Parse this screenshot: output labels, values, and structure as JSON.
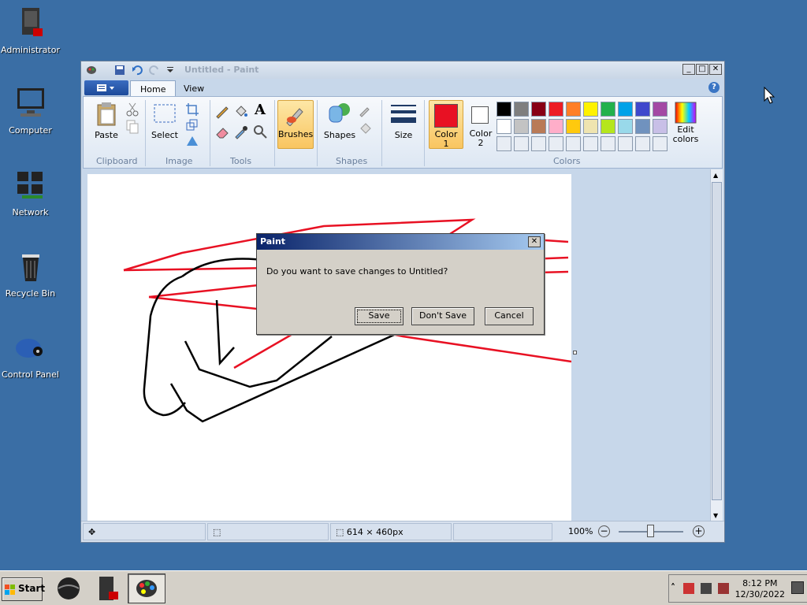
{
  "desktop": {
    "icons": [
      {
        "label": "Administrator",
        "icon": "user-folder-icon"
      },
      {
        "label": "Computer",
        "icon": "computer-icon"
      },
      {
        "label": "Network",
        "icon": "network-icon"
      },
      {
        "label": "Recycle Bin",
        "icon": "recycle-bin-icon"
      },
      {
        "label": "Control Panel",
        "icon": "control-panel-icon"
      }
    ]
  },
  "window": {
    "title": "Untitled - Paint",
    "buttons": {
      "minimize": "_",
      "maximize": "□",
      "close": "✕"
    }
  },
  "ribbon": {
    "tabs": [
      "Home",
      "View"
    ],
    "clipboard": {
      "paste": "Paste",
      "group": "Clipboard"
    },
    "image": {
      "select": "Select",
      "group": "Image"
    },
    "tools": {
      "group": "Tools",
      "text_tool": "A"
    },
    "brushes": "Brushes",
    "shapes": {
      "label": "Shapes",
      "group": "Shapes"
    },
    "size": "Size",
    "color1": {
      "label": "Color",
      "num": "1",
      "value": "#e81123"
    },
    "color2": {
      "label": "Color",
      "num": "2",
      "value": "#ffffff"
    },
    "colors_group": "Colors",
    "edit_colors": {
      "line1": "Edit",
      "line2": "colors"
    },
    "palette_row1": [
      "#000000",
      "#7f7f7f",
      "#880015",
      "#ed1c24",
      "#ff7f27",
      "#fff200",
      "#22b14c",
      "#00a2e8",
      "#3f48cc",
      "#a349a4"
    ],
    "palette_row2": [
      "#ffffff",
      "#c3c3c3",
      "#b97a57",
      "#ffaec9",
      "#ffc90e",
      "#efe4b0",
      "#b5e61d",
      "#99d9ea",
      "#7092be",
      "#c8bfe7"
    ]
  },
  "statusbar": {
    "dimensions": "614 × 460px",
    "zoom": "100%",
    "zoom_out": "−",
    "zoom_in": "+"
  },
  "dialog": {
    "title": "Paint",
    "message": "Do you want to save changes to Untitled?",
    "save": "Save",
    "dont_save": "Don't Save",
    "cancel": "Cancel",
    "close": "✕"
  },
  "taskbar": {
    "start": "Start",
    "time": "8:12 PM",
    "date": "12/30/2022",
    "tray_expand": "˄"
  }
}
